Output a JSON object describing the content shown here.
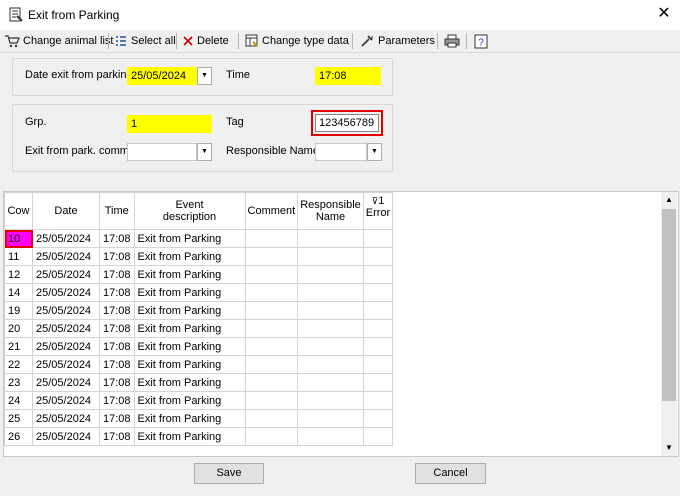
{
  "window": {
    "title": "Exit from Parking"
  },
  "toolbar": {
    "change_animal_list": "Change animal list",
    "select_all": "Select all",
    "delete": "Delete",
    "change_type_data": "Change type data",
    "parameters": "Parameters"
  },
  "form": {
    "date_exit_label": "Date exit from parking",
    "date_exit_value": "25/05/2024",
    "time_label": "Time",
    "time_value": "17:08",
    "grp_label": "Grp.",
    "grp_value": "1",
    "tag_label": "Tag",
    "tag_value": "123456789",
    "comment_label": "Exit from park. comm.",
    "comment_value": "",
    "responsible_label": "Responsible Name",
    "responsible_value": ""
  },
  "grid": {
    "headers": {
      "cow": "Cow",
      "date": "Date",
      "time": "Time",
      "event_1": "Event",
      "event_2": "description",
      "comment": "Comment",
      "responsible_1": "Responsible",
      "responsible_2": "Name",
      "error_1": "1",
      "error_2": "Error"
    },
    "rows": [
      {
        "cow": "10",
        "date": "25/05/2024",
        "time": "17:08",
        "event": "Exit from Parking",
        "comment": "",
        "responsible": "",
        "error": ""
      },
      {
        "cow": "11",
        "date": "25/05/2024",
        "time": "17:08",
        "event": "Exit from Parking",
        "comment": "",
        "responsible": "",
        "error": ""
      },
      {
        "cow": "12",
        "date": "25/05/2024",
        "time": "17:08",
        "event": "Exit from Parking",
        "comment": "",
        "responsible": "",
        "error": ""
      },
      {
        "cow": "14",
        "date": "25/05/2024",
        "time": "17:08",
        "event": "Exit from Parking",
        "comment": "",
        "responsible": "",
        "error": ""
      },
      {
        "cow": "19",
        "date": "25/05/2024",
        "time": "17:08",
        "event": "Exit from Parking",
        "comment": "",
        "responsible": "",
        "error": ""
      },
      {
        "cow": "20",
        "date": "25/05/2024",
        "time": "17:08",
        "event": "Exit from Parking",
        "comment": "",
        "responsible": "",
        "error": ""
      },
      {
        "cow": "21",
        "date": "25/05/2024",
        "time": "17:08",
        "event": "Exit from Parking",
        "comment": "",
        "responsible": "",
        "error": ""
      },
      {
        "cow": "22",
        "date": "25/05/2024",
        "time": "17:08",
        "event": "Exit from Parking",
        "comment": "",
        "responsible": "",
        "error": ""
      },
      {
        "cow": "23",
        "date": "25/05/2024",
        "time": "17:08",
        "event": "Exit from Parking",
        "comment": "",
        "responsible": "",
        "error": ""
      },
      {
        "cow": "24",
        "date": "25/05/2024",
        "time": "17:08",
        "event": "Exit from Parking",
        "comment": "",
        "responsible": "",
        "error": ""
      },
      {
        "cow": "25",
        "date": "25/05/2024",
        "time": "17:08",
        "event": "Exit from Parking",
        "comment": "",
        "responsible": "",
        "error": ""
      },
      {
        "cow": "26",
        "date": "25/05/2024",
        "time": "17:08",
        "event": "Exit from Parking",
        "comment": "",
        "responsible": "",
        "error": ""
      }
    ]
  },
  "buttons": {
    "save": "Save",
    "cancel": "Cancel"
  },
  "colors": {
    "highlight_yellow": "#ffff00",
    "selected_cell": "#ff00ff",
    "focus_frame": "#e30000"
  }
}
